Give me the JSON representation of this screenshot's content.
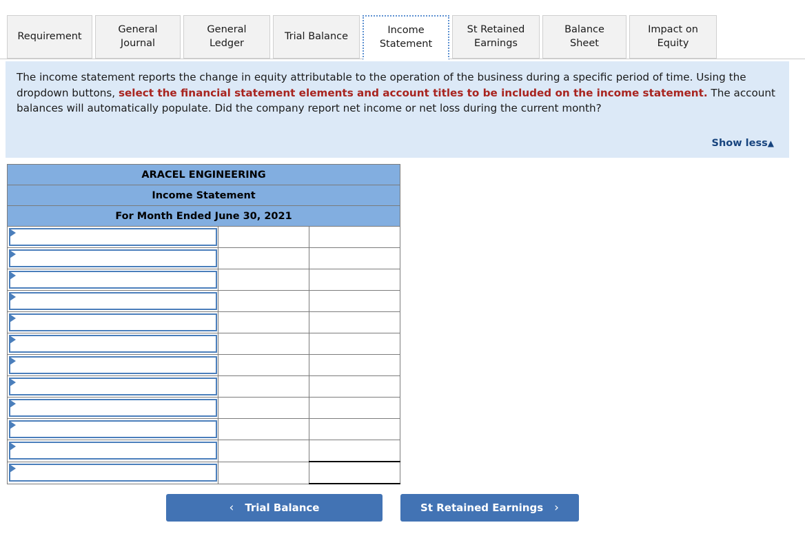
{
  "tabs": [
    {
      "label": "Requirement",
      "active": false,
      "width": 124
    },
    {
      "label": "General\nJournal",
      "active": false,
      "width": 124
    },
    {
      "label": "General\nLedger",
      "active": false,
      "width": 126
    },
    {
      "label": "Trial Balance",
      "active": false,
      "width": 126
    },
    {
      "label": "Income\nStatement",
      "active": true,
      "width": 126
    },
    {
      "label": "St Retained\nEarnings",
      "active": false,
      "width": 127
    },
    {
      "label": "Balance Sheet",
      "active": false,
      "width": 122
    },
    {
      "label": "Impact on\nEquity",
      "active": false,
      "width": 127
    }
  ],
  "instructions": {
    "part1": "The income statement reports the change in equity attributable to the operation of the business during a specific period of time.  Using the dropdown buttons, ",
    "highlight": "select the financial statement elements and account titles to be included on the income statement.",
    "part2": " The account balances will automatically populate. Did the company report net income or net loss during the current month?",
    "show_less_label": "Show less",
    "show_less_caret": "▲"
  },
  "statement": {
    "company": "ARACEL ENGINEERING",
    "title": "Income Statement",
    "period": "For Month Ended June 30, 2021",
    "rows": [
      {
        "label": "",
        "amount1": "",
        "amount2": "",
        "total": false
      },
      {
        "label": "",
        "amount1": "",
        "amount2": "",
        "total": false
      },
      {
        "label": "",
        "amount1": "",
        "amount2": "",
        "total": false
      },
      {
        "label": "",
        "amount1": "",
        "amount2": "",
        "total": false
      },
      {
        "label": "",
        "amount1": "",
        "amount2": "",
        "total": false
      },
      {
        "label": "",
        "amount1": "",
        "amount2": "",
        "total": false
      },
      {
        "label": "",
        "amount1": "",
        "amount2": "",
        "total": false
      },
      {
        "label": "",
        "amount1": "",
        "amount2": "",
        "total": false
      },
      {
        "label": "",
        "amount1": "",
        "amount2": "",
        "total": false
      },
      {
        "label": "",
        "amount1": "",
        "amount2": "",
        "total": false
      },
      {
        "label": "",
        "amount1": "",
        "amount2": "",
        "total": false
      },
      {
        "label": "",
        "amount1": "",
        "amount2": "",
        "total": true
      }
    ]
  },
  "nav": {
    "prev_label": "Trial Balance",
    "prev_chevron": "‹",
    "next_label": "St Retained Earnings",
    "next_chevron": "›"
  },
  "colors": {
    "header_blue": "#82aee0",
    "panel_blue": "#dce9f7",
    "highlight_red": "#a8241f",
    "link_blue": "#17447e",
    "button_blue": "#4273b4",
    "dropdown_border": "#4a7ebb"
  }
}
